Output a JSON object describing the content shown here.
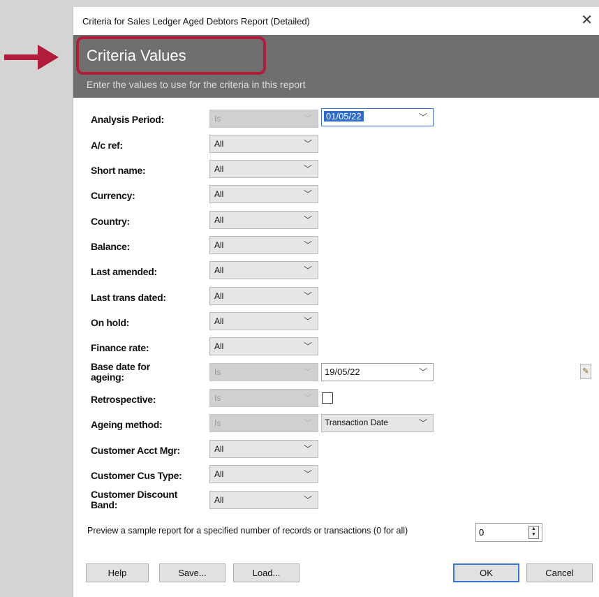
{
  "dialog": {
    "title": "Criteria for Sales Ledger Aged Debtors Report (Detailed)",
    "close_label": "✕"
  },
  "header": {
    "title": "Criteria Values",
    "subtitle": "Enter the values to use for the criteria in this report"
  },
  "criteria": {
    "analysis_period": {
      "label": "Analysis Period:",
      "op": "Is",
      "value": "01/05/22"
    },
    "ac_ref": {
      "label": "A/c ref:",
      "op": "All"
    },
    "short_name": {
      "label": "Short name:",
      "op": "All"
    },
    "currency": {
      "label": "Currency:",
      "op": "All"
    },
    "country": {
      "label": "Country:",
      "op": "All"
    },
    "balance": {
      "label": "Balance:",
      "op": "All"
    },
    "last_amended": {
      "label": "Last amended:",
      "op": "All"
    },
    "last_trans_dated": {
      "label": "Last trans dated:",
      "op": "All"
    },
    "on_hold": {
      "label": "On hold:",
      "op": "All"
    },
    "finance_rate": {
      "label": "Finance rate:",
      "op": "All"
    },
    "base_date": {
      "label_line1": "Base date for",
      "label_line2": "ageing:",
      "op": "Is",
      "value": "19/05/22"
    },
    "retrospective": {
      "label": "Retrospective:",
      "op": "Is"
    },
    "ageing_method": {
      "label": "Ageing method:",
      "op": "Is",
      "value": "Transaction Date"
    },
    "customer_acct_mgr": {
      "label": "Customer Acct Mgr:",
      "op": "All"
    },
    "customer_cus_type": {
      "label": "Customer Cus Type:",
      "op": "All"
    },
    "customer_discount_band": {
      "label_line1": "Customer Discount",
      "label_line2": "Band:",
      "op": "All"
    }
  },
  "preview": {
    "text": "Preview a sample report for a specified number of records or transactions (0 for all)",
    "value": "0"
  },
  "buttons": {
    "help": "Help",
    "save": "Save...",
    "load": "Load...",
    "ok": "OK",
    "cancel": "Cancel"
  },
  "colors": {
    "header_band": "#6f6f6f",
    "highlight": "#b01c3a",
    "arrow": "#b01c3a",
    "selection": "#2d6bd1"
  },
  "icons": {
    "arrow": "right-arrow-annotation",
    "close": "close-icon",
    "chevron": "chevron-down-icon",
    "edit": "pencil-icon",
    "spinner": "spinner-arrows-icon"
  }
}
